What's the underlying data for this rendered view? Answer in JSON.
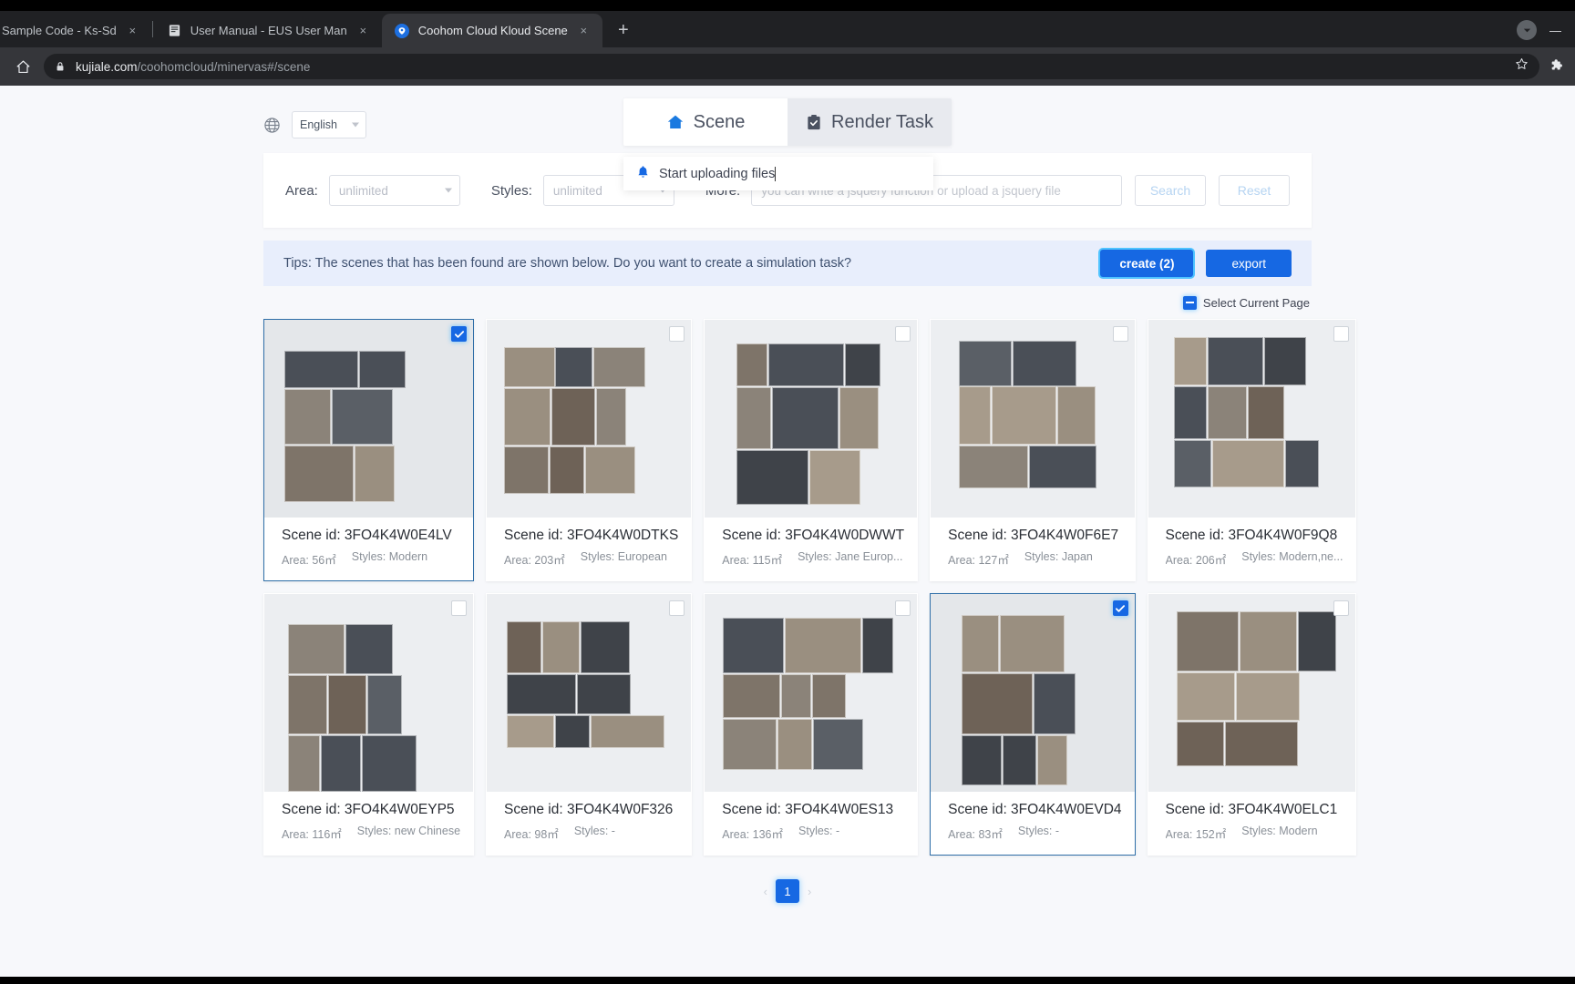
{
  "browser": {
    "tabs": [
      {
        "title": "Sample Code - Ks-Sd",
        "favicon": "none-icon",
        "active": false
      },
      {
        "title": "User Manual - EUS User Manu",
        "favicon": "book-icon",
        "active": false
      },
      {
        "title": "Coohom Cloud Kloud Scene",
        "favicon": "coohom-icon",
        "active": true
      }
    ],
    "new_tab_label": "+",
    "close_label": "×",
    "minimize_label": "—",
    "url_domain": "kujiale.com",
    "url_path": "/coohomcloud/minervas#/scene"
  },
  "topbar": {
    "language": "English",
    "tabs": [
      {
        "label": "Scene",
        "icon": "home-icon",
        "active": true
      },
      {
        "label": "Render Task",
        "icon": "clipboard-check-icon",
        "active": false
      }
    ]
  },
  "toast": {
    "icon": "bell-icon",
    "text": "Start uploading files"
  },
  "search": {
    "area_label": "Area:",
    "area_value": "unlimited",
    "styles_label": "Styles:",
    "styles_value": "unlimited",
    "more_label": "More:",
    "more_value": "",
    "more_placeholder": "you can write a jsquery function or upload a jsquery file",
    "search_button": "Search",
    "reset_button": "Reset"
  },
  "tips": {
    "text": "Tips: The scenes that has been found are shown below. Do you want to create a simulation task?",
    "create_button": "create (2)",
    "export_button": "export"
  },
  "select_row": {
    "label": "Select Current Page",
    "checkbox_state": "indeterminate"
  },
  "colors": {
    "accent": "#1668e3",
    "tips_bg": "#e8eefc",
    "focus_ring": "#4fc3ff",
    "selected_border": "#2f6fa8"
  },
  "scenes": [
    {
      "title": "Scene id: 3FO4K4W0E4LV",
      "area": "Area: 56㎡",
      "styles": "Styles: Modern",
      "selected": true
    },
    {
      "title": "Scene id: 3FO4K4W0DTKS",
      "area": "Area: 203㎡",
      "styles": "Styles: European",
      "selected": false
    },
    {
      "title": "Scene id: 3FO4K4W0DWWT",
      "area": "Area: 115㎡",
      "styles": "Styles: Jane Europ...",
      "selected": false
    },
    {
      "title": "Scene id: 3FO4K4W0F6E7",
      "area": "Area: 127㎡",
      "styles": "Styles: Japan",
      "selected": false
    },
    {
      "title": "Scene id: 3FO4K4W0F9Q8",
      "area": "Area: 206㎡",
      "styles": "Styles: Modern,ne...",
      "selected": false
    },
    {
      "title": "Scene id: 3FO4K4W0EYP5",
      "area": "Area: 116㎡",
      "styles": "Styles: new Chinese",
      "selected": false
    },
    {
      "title": "Scene id: 3FO4K4W0F326",
      "area": "Area: 98㎡",
      "styles": "Styles: -",
      "selected": false
    },
    {
      "title": "Scene id: 3FO4K4W0ES13",
      "area": "Area: 136㎡",
      "styles": "Styles: -",
      "selected": false
    },
    {
      "title": "Scene id: 3FO4K4W0EVD4",
      "area": "Area: 83㎡",
      "styles": "Styles: -",
      "selected": true
    },
    {
      "title": "Scene id: 3FO4K4W0ELC1",
      "area": "Area: 152㎡",
      "styles": "Styles: Modern",
      "selected": false
    }
  ],
  "pagination": {
    "prev": "‹",
    "next": "›",
    "current_page": "1"
  }
}
